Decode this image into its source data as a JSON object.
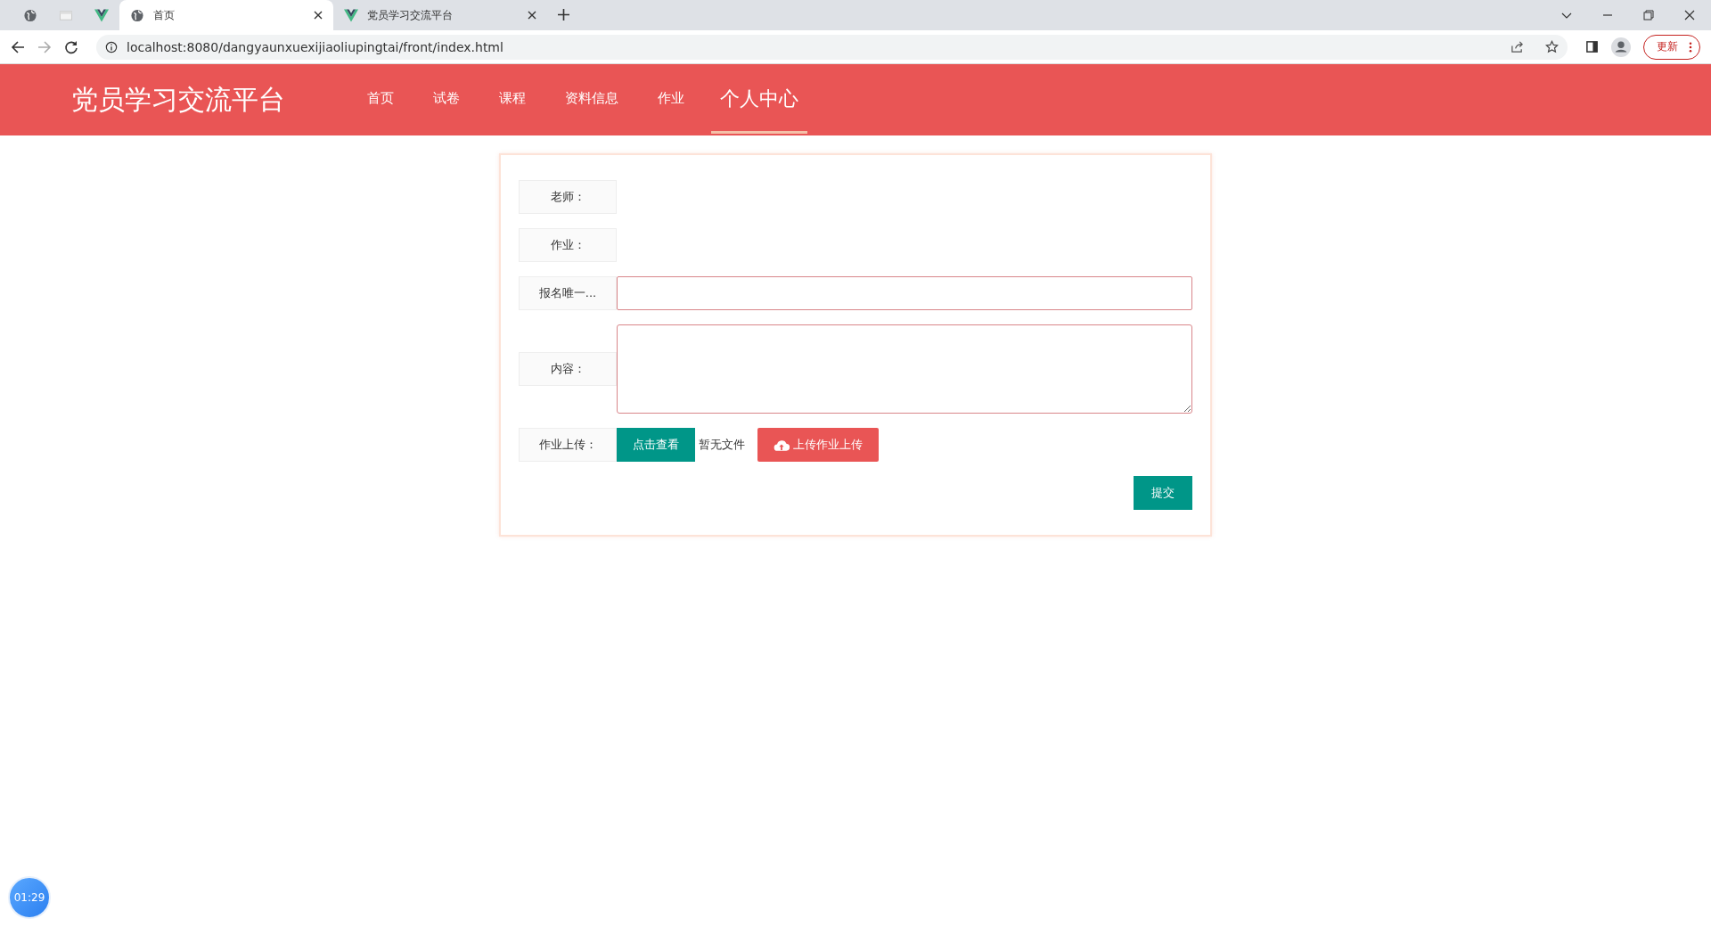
{
  "browser": {
    "tabs": [
      {
        "kind": "globe",
        "selected": false
      },
      {
        "kind": "page",
        "selected": false
      },
      {
        "kind": "vue",
        "selected": false
      },
      {
        "kind": "globe",
        "title": "首页",
        "selected": true
      },
      {
        "kind": "vue",
        "title": "党员学习交流平台",
        "selected": false
      }
    ],
    "address": "localhost:8080/dangyaunxuexijiaoliupingtai/front/index.html",
    "update_button": "更新"
  },
  "header": {
    "logo": "党员学习交流平台",
    "nav": [
      {
        "label": "首页",
        "selected": false
      },
      {
        "label": "试卷",
        "selected": false
      },
      {
        "label": "课程",
        "selected": false
      },
      {
        "label": "资料信息",
        "selected": false
      },
      {
        "label": "作业",
        "selected": false
      },
      {
        "label": "个人中心",
        "selected": true
      }
    ]
  },
  "form": {
    "fields": [
      {
        "kind": "text",
        "label": "老师："
      },
      {
        "kind": "text",
        "label": "作业："
      },
      {
        "kind": "input",
        "label": "报名唯一..."
      },
      {
        "kind": "textarea",
        "label": "内容："
      },
      {
        "kind": "upload",
        "label": "作业上传：",
        "view_button": "点击查看",
        "file_status": "暂无文件",
        "upload_button": "上传作业上传"
      }
    ],
    "submit_button": "提交"
  },
  "timer": "01:29"
}
